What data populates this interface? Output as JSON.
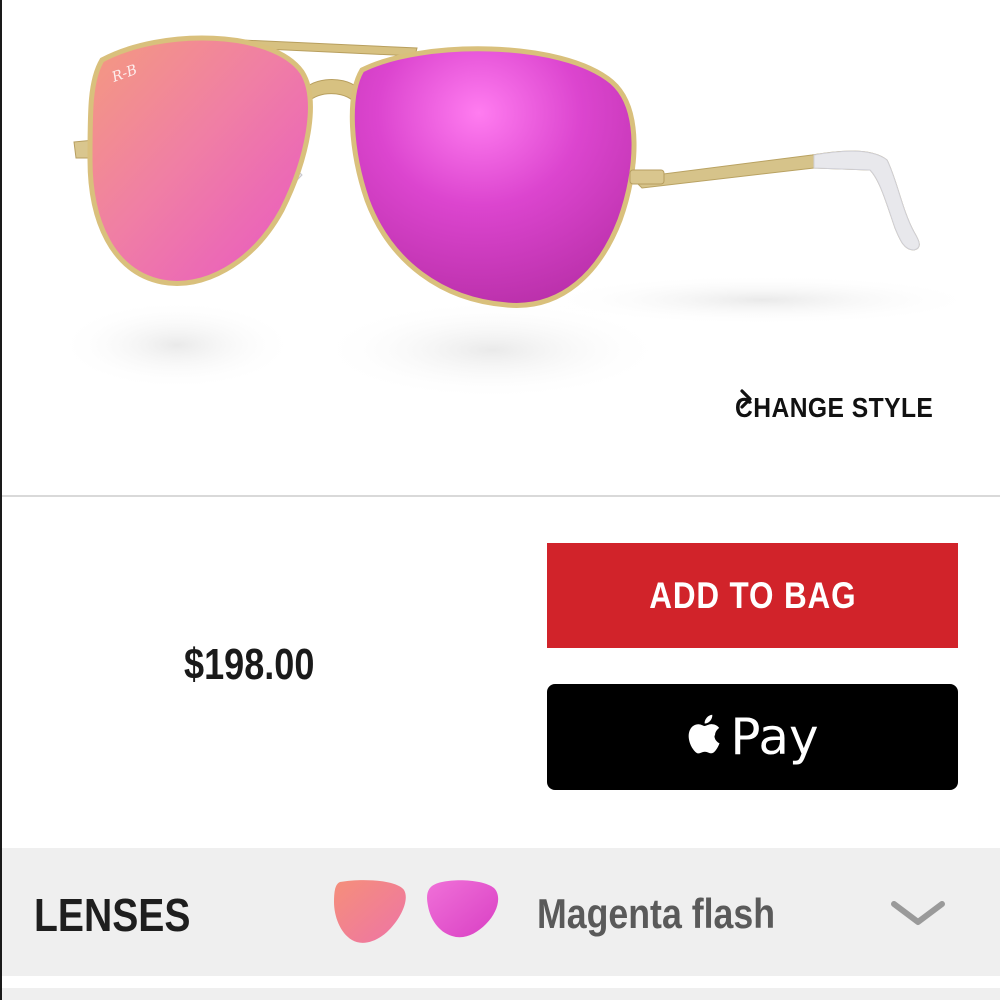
{
  "product": {
    "image_name": "aviator-sunglasses-magenta-flash",
    "change_style_label": "CHANGE STYLE",
    "price": "$198.00"
  },
  "actions": {
    "add_to_bag_label": "ADD TO BAG",
    "apple_pay_label": "Pay"
  },
  "lenses": {
    "label": "LENSES",
    "selected_name": "Magenta flash"
  },
  "colors": {
    "accent_red": "#d1232a",
    "apple_pay_black": "#000000",
    "lens_pink": "#e03fd0",
    "lens_orange": "#f08a86",
    "frame_gold": "#d4b877",
    "row_gray": "#efefef"
  },
  "icons": {
    "change_style": "chevron-right-icon",
    "apple_pay": "apple-icon",
    "lenses_expand": "chevron-down-icon"
  }
}
